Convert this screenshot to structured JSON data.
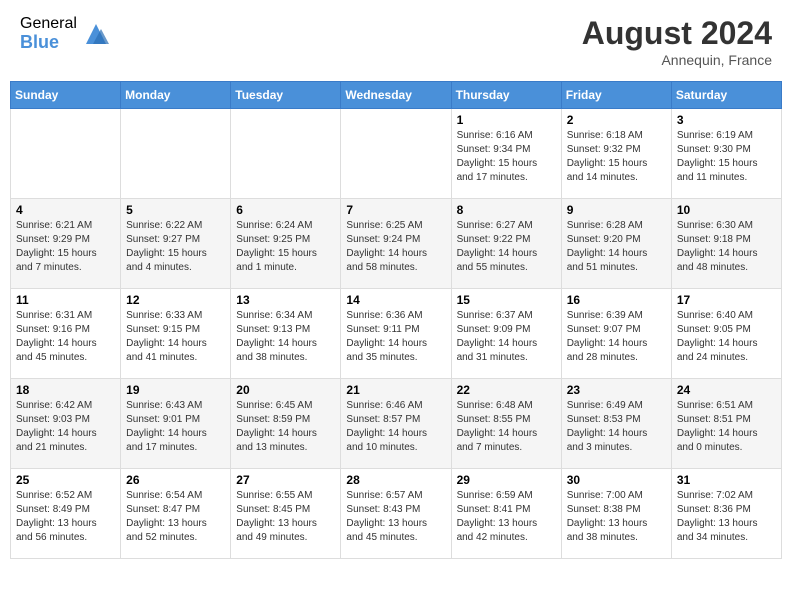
{
  "header": {
    "logo_general": "General",
    "logo_blue": "Blue",
    "month_year": "August 2024",
    "location": "Annequin, France"
  },
  "weekdays": [
    "Sunday",
    "Monday",
    "Tuesday",
    "Wednesday",
    "Thursday",
    "Friday",
    "Saturday"
  ],
  "weeks": [
    [
      {
        "day": "",
        "info": ""
      },
      {
        "day": "",
        "info": ""
      },
      {
        "day": "",
        "info": ""
      },
      {
        "day": "",
        "info": ""
      },
      {
        "day": "1",
        "info": "Sunrise: 6:16 AM\nSunset: 9:34 PM\nDaylight: 15 hours and 17 minutes."
      },
      {
        "day": "2",
        "info": "Sunrise: 6:18 AM\nSunset: 9:32 PM\nDaylight: 15 hours and 14 minutes."
      },
      {
        "day": "3",
        "info": "Sunrise: 6:19 AM\nSunset: 9:30 PM\nDaylight: 15 hours and 11 minutes."
      }
    ],
    [
      {
        "day": "4",
        "info": "Sunrise: 6:21 AM\nSunset: 9:29 PM\nDaylight: 15 hours and 7 minutes."
      },
      {
        "day": "5",
        "info": "Sunrise: 6:22 AM\nSunset: 9:27 PM\nDaylight: 15 hours and 4 minutes."
      },
      {
        "day": "6",
        "info": "Sunrise: 6:24 AM\nSunset: 9:25 PM\nDaylight: 15 hours and 1 minute."
      },
      {
        "day": "7",
        "info": "Sunrise: 6:25 AM\nSunset: 9:24 PM\nDaylight: 14 hours and 58 minutes."
      },
      {
        "day": "8",
        "info": "Sunrise: 6:27 AM\nSunset: 9:22 PM\nDaylight: 14 hours and 55 minutes."
      },
      {
        "day": "9",
        "info": "Sunrise: 6:28 AM\nSunset: 9:20 PM\nDaylight: 14 hours and 51 minutes."
      },
      {
        "day": "10",
        "info": "Sunrise: 6:30 AM\nSunset: 9:18 PM\nDaylight: 14 hours and 48 minutes."
      }
    ],
    [
      {
        "day": "11",
        "info": "Sunrise: 6:31 AM\nSunset: 9:16 PM\nDaylight: 14 hours and 45 minutes."
      },
      {
        "day": "12",
        "info": "Sunrise: 6:33 AM\nSunset: 9:15 PM\nDaylight: 14 hours and 41 minutes."
      },
      {
        "day": "13",
        "info": "Sunrise: 6:34 AM\nSunset: 9:13 PM\nDaylight: 14 hours and 38 minutes."
      },
      {
        "day": "14",
        "info": "Sunrise: 6:36 AM\nSunset: 9:11 PM\nDaylight: 14 hours and 35 minutes."
      },
      {
        "day": "15",
        "info": "Sunrise: 6:37 AM\nSunset: 9:09 PM\nDaylight: 14 hours and 31 minutes."
      },
      {
        "day": "16",
        "info": "Sunrise: 6:39 AM\nSunset: 9:07 PM\nDaylight: 14 hours and 28 minutes."
      },
      {
        "day": "17",
        "info": "Sunrise: 6:40 AM\nSunset: 9:05 PM\nDaylight: 14 hours and 24 minutes."
      }
    ],
    [
      {
        "day": "18",
        "info": "Sunrise: 6:42 AM\nSunset: 9:03 PM\nDaylight: 14 hours and 21 minutes."
      },
      {
        "day": "19",
        "info": "Sunrise: 6:43 AM\nSunset: 9:01 PM\nDaylight: 14 hours and 17 minutes."
      },
      {
        "day": "20",
        "info": "Sunrise: 6:45 AM\nSunset: 8:59 PM\nDaylight: 14 hours and 13 minutes."
      },
      {
        "day": "21",
        "info": "Sunrise: 6:46 AM\nSunset: 8:57 PM\nDaylight: 14 hours and 10 minutes."
      },
      {
        "day": "22",
        "info": "Sunrise: 6:48 AM\nSunset: 8:55 PM\nDaylight: 14 hours and 7 minutes."
      },
      {
        "day": "23",
        "info": "Sunrise: 6:49 AM\nSunset: 8:53 PM\nDaylight: 14 hours and 3 minutes."
      },
      {
        "day": "24",
        "info": "Sunrise: 6:51 AM\nSunset: 8:51 PM\nDaylight: 14 hours and 0 minutes."
      }
    ],
    [
      {
        "day": "25",
        "info": "Sunrise: 6:52 AM\nSunset: 8:49 PM\nDaylight: 13 hours and 56 minutes."
      },
      {
        "day": "26",
        "info": "Sunrise: 6:54 AM\nSunset: 8:47 PM\nDaylight: 13 hours and 52 minutes."
      },
      {
        "day": "27",
        "info": "Sunrise: 6:55 AM\nSunset: 8:45 PM\nDaylight: 13 hours and 49 minutes."
      },
      {
        "day": "28",
        "info": "Sunrise: 6:57 AM\nSunset: 8:43 PM\nDaylight: 13 hours and 45 minutes."
      },
      {
        "day": "29",
        "info": "Sunrise: 6:59 AM\nSunset: 8:41 PM\nDaylight: 13 hours and 42 minutes."
      },
      {
        "day": "30",
        "info": "Sunrise: 7:00 AM\nSunset: 8:38 PM\nDaylight: 13 hours and 38 minutes."
      },
      {
        "day": "31",
        "info": "Sunrise: 7:02 AM\nSunset: 8:36 PM\nDaylight: 13 hours and 34 minutes."
      }
    ]
  ]
}
